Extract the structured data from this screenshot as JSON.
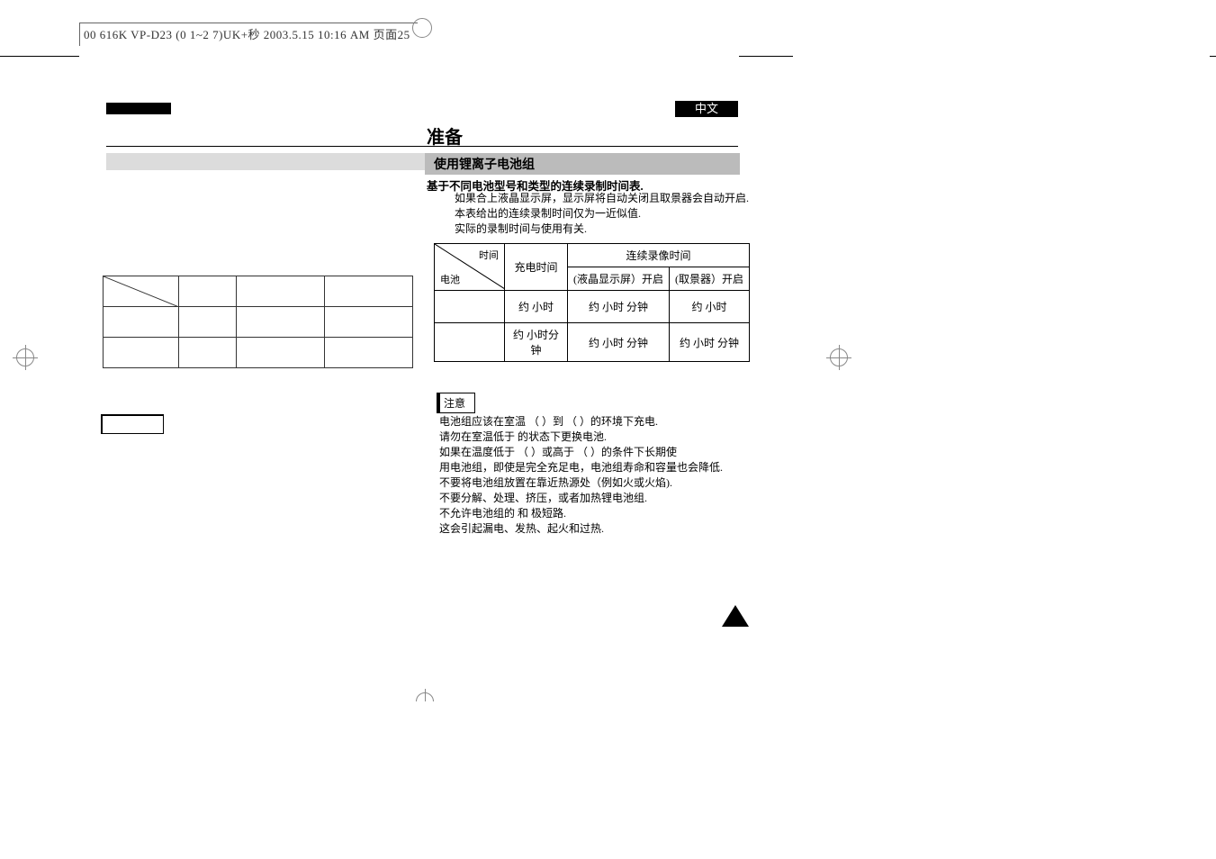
{
  "doc_header": "00 616K VP-D23 (0 1~2 7)UK+秒 2003.5.15 10:16 AM 页面25",
  "lang_label": "中文",
  "title": "准备",
  "section_heading": "使用锂离子电池组",
  "subtitle": "基于不同电池型号和类型的连续录制时间表.",
  "body_line1": "如果合上液晶显示屏，显示屏将自动关闭且取景器会自动开启.",
  "body_line2": "本表给出的连续录制时间仅为一近似值.",
  "body_line3": "实际的录制时间与使用有关.",
  "table": {
    "diag_top": "时间",
    "diag_bottom": "电池",
    "charge_header": "充电时间",
    "rec_header": "连续录像时间",
    "lcd_header": "(液晶显示屏）开启",
    "evf_header": "(取景器）开启",
    "row1_charge": "约 小时",
    "row1_lcd": "约 小时  分钟",
    "row1_evf": "约 小时",
    "row2_charge": "约 小时分钟",
    "row2_lcd": "约 小时  分钟",
    "row2_evf": "约 小时  分钟"
  },
  "notes_label": "注意",
  "notes": {
    "n1": "电池组应该在室温        （    ）到          （    ）的环境下充电.",
    "n2": "请勿在室温低于            的状态下更换电池.",
    "n3": "如果在温度低于        （    ）或高于            （    ）的条件下长期使",
    "n3b": "用电池组，即使是完全充足电，电池组寿命和容量也会降低.",
    "n4": "不要将电池组放置在靠近热源处（例如火或火焰).",
    "n5": "不要分解、处理、挤压，或者加热锂电池组.",
    "n6": "不允许电池组的 和 极短路.",
    "n7": "这会引起漏电、发热、起火和过热."
  }
}
